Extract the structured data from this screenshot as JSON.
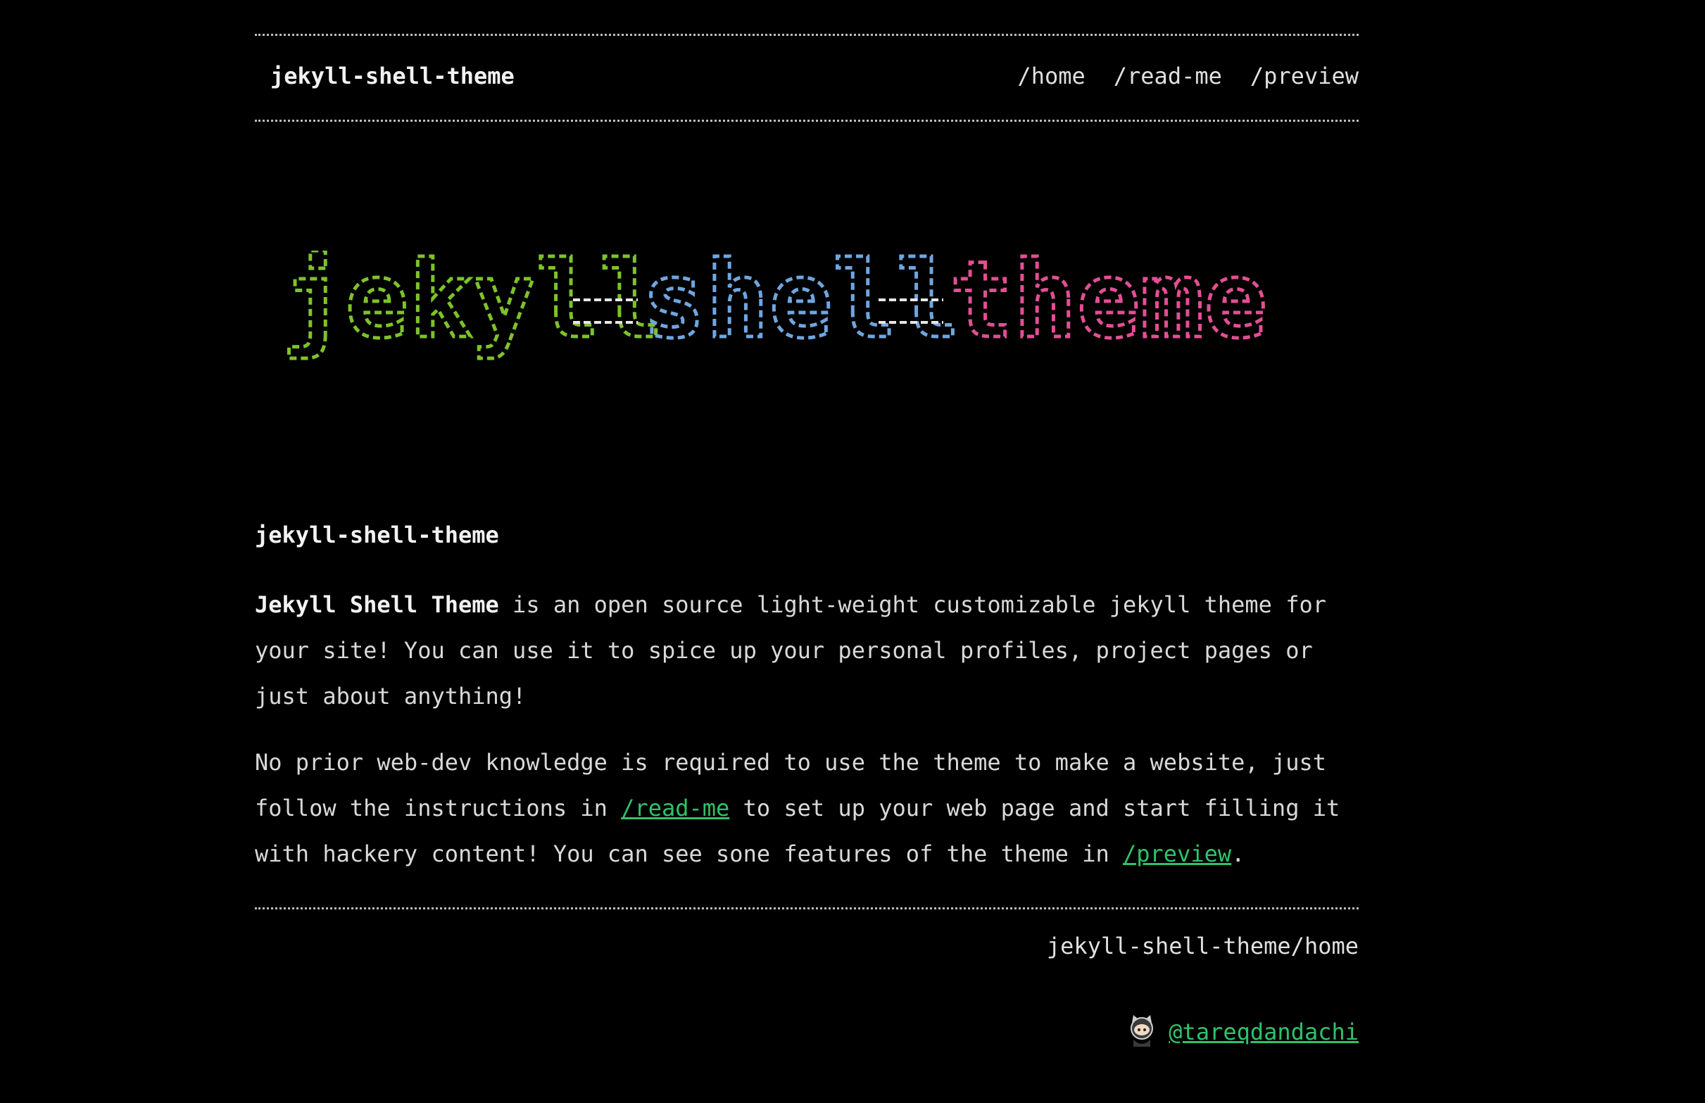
{
  "header": {
    "site_title": "jekyll-shell-theme",
    "nav": [
      "/home",
      "/read-me",
      "/preview"
    ]
  },
  "banner": {
    "text": [
      "jekyll",
      "shell",
      "theme"
    ],
    "colors": [
      "#7ec32a",
      "#6fa6e0",
      "#e24f94"
    ],
    "icon": "ascii-art-banner"
  },
  "post": {
    "title": "jekyll-shell-theme",
    "intro_bold": "Jekyll Shell Theme",
    "intro_rest_1": " is an open source light-weight customizable jekyll theme for",
    "intro_line_2": "your site! You can use it to spice up your personal profiles, project pages or",
    "intro_line_3": "just about anything!",
    "p2_line_1": "No prior web-dev knowledge is required to use the theme to make a website, just",
    "p2_line_2_pre": "follow the instructions in ",
    "p2_link_1": "/read-me",
    "p2_line_2_post": " to set up your web page and start filling it",
    "p2_line_3_pre": "with hackery content! You can see sone features of the theme in ",
    "p2_link_2": "/preview",
    "p2_line_3_post": "."
  },
  "footer": {
    "path": "jekyll-shell-theme/home",
    "author_link": "@tareqdandachi",
    "author_icon": "octocat-icon"
  },
  "colors": {
    "background": "#000000",
    "text": "#d9d9d9",
    "link": "#2fc26a"
  }
}
